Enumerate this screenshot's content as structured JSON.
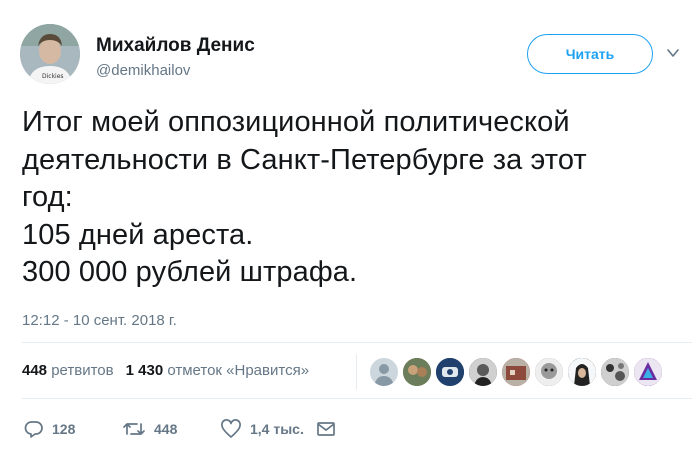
{
  "user": {
    "name": "Михайлов Денис",
    "handle": "@demikhailov"
  },
  "follow_button": {
    "label": "Читать"
  },
  "tweet": {
    "text": "Итог моей оппозиционной политической\nдеятельности в Санкт-Петербурге за этот\nгод:\n105 дней ареста.\n300 000 рублей штрафа.",
    "timestamp": "12:12 - 10 сент. 2018 г."
  },
  "stats": {
    "retweets_count": "448",
    "retweets_label": "ретвитов",
    "likes_count": "1 430",
    "likes_label": "отметок «Нравится»"
  },
  "actions": {
    "reply_count": "128",
    "retweet_count": "448",
    "like_count": "1,4 тыс."
  },
  "colors": {
    "accent": "#1da1f2",
    "text": "#14171a",
    "secondary": "#657786",
    "divider": "#e6ecf0"
  },
  "icons": [
    "reply-icon",
    "retweet-icon",
    "heart-icon",
    "envelope-icon",
    "chevron-down-icon"
  ]
}
